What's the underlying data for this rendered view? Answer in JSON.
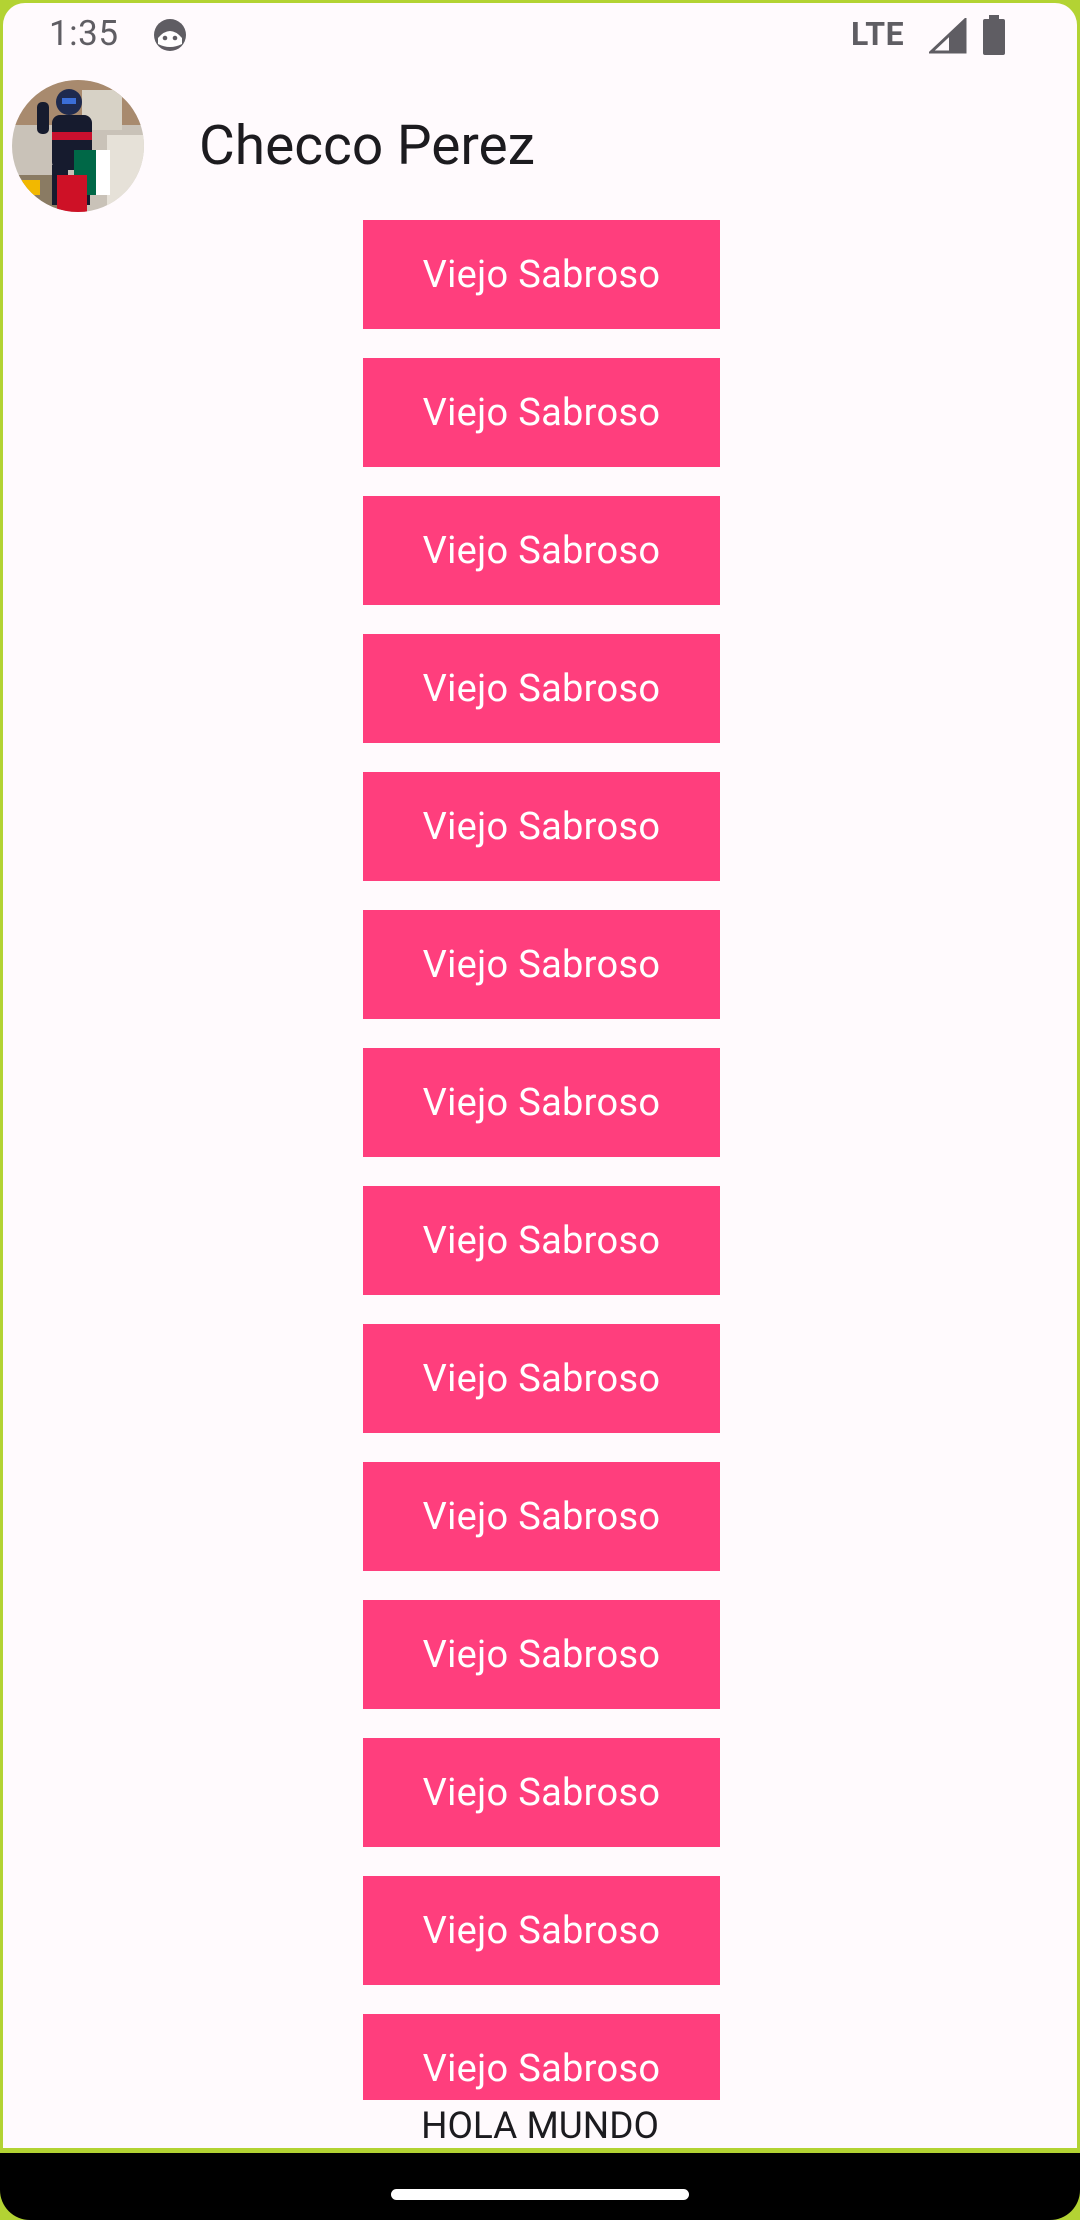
{
  "status_bar": {
    "time": "1:35",
    "network": "LTE",
    "icons": {
      "notification": "android-face-icon",
      "signal": "cell-signal-icon",
      "battery": "battery-icon"
    }
  },
  "header": {
    "avatar": "profile-photo",
    "title": "Checco Perez"
  },
  "buttons": [
    {
      "label": "Viejo Sabroso"
    },
    {
      "label": "Viejo Sabroso"
    },
    {
      "label": "Viejo Sabroso"
    },
    {
      "label": "Viejo Sabroso"
    },
    {
      "label": "Viejo Sabroso"
    },
    {
      "label": "Viejo Sabroso"
    },
    {
      "label": "Viejo Sabroso"
    },
    {
      "label": "Viejo Sabroso"
    },
    {
      "label": "Viejo Sabroso"
    },
    {
      "label": "Viejo Sabroso"
    },
    {
      "label": "Viejo Sabroso"
    },
    {
      "label": "Viejo Sabroso"
    },
    {
      "label": "Viejo Sabroso"
    },
    {
      "label": "Viejo Sabroso"
    }
  ],
  "footer": {
    "text": "HOLA MUNDO"
  },
  "colors": {
    "button_bg": "#ff3e7d",
    "button_text": "#ffffff",
    "screen_bg": "#fffafd",
    "frame": "#b3d333"
  }
}
